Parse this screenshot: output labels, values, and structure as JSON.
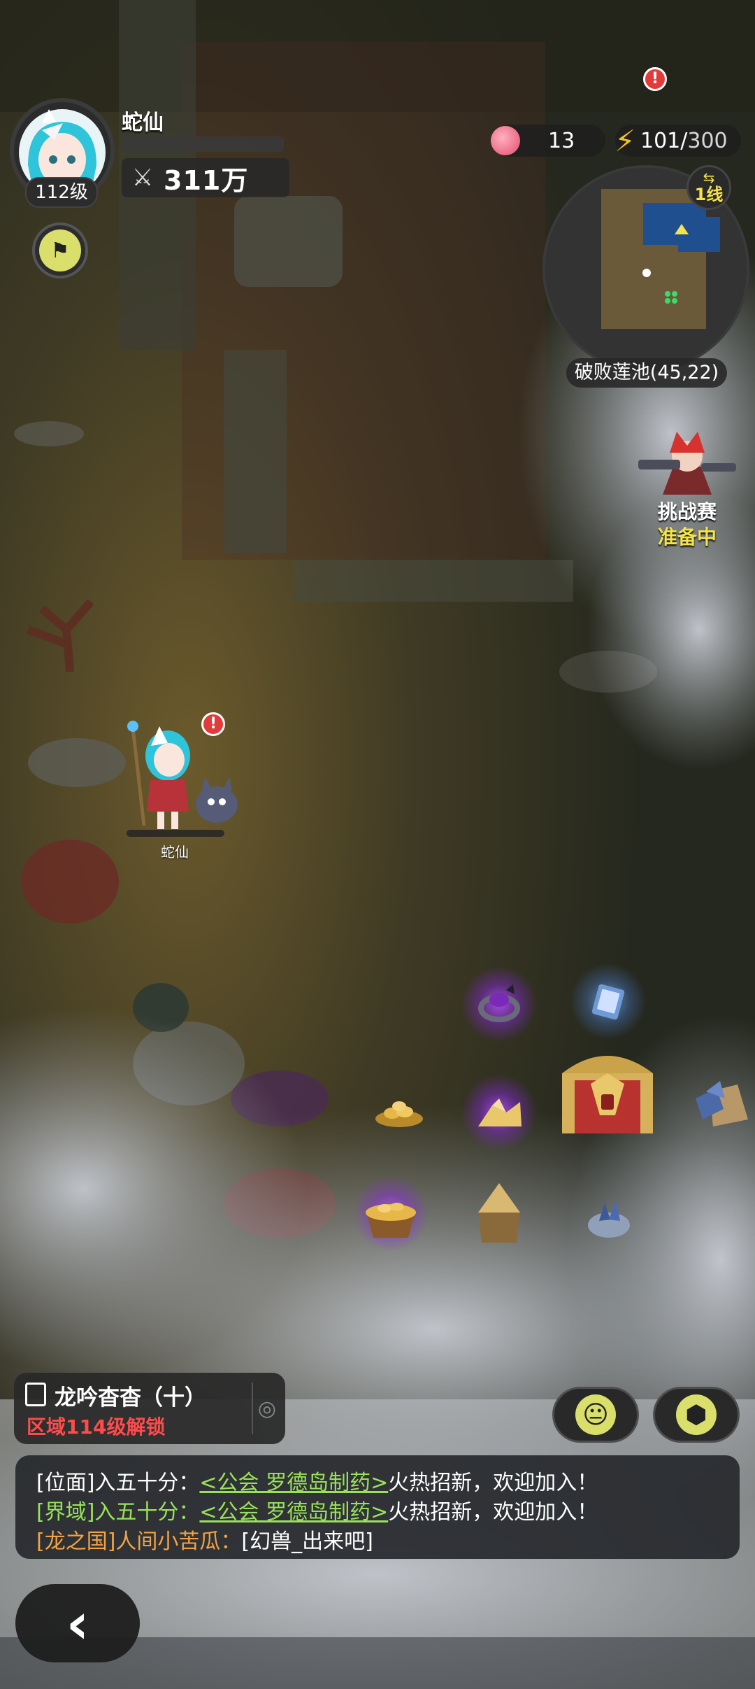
{
  "player": {
    "name": "蛇仙",
    "level": "112级",
    "power": "311万"
  },
  "resources": {
    "peach_count": "13",
    "energy_current": "101/",
    "energy_max": "300"
  },
  "minimap": {
    "line": "1线",
    "location": "破败莲池(45,22)"
  },
  "challenge": {
    "title": "挑战赛",
    "status": "准备中"
  },
  "character": {
    "name": "蛇仙"
  },
  "quest": {
    "title": "龙吟杳杳（十）",
    "requirement": "区域114级解锁"
  },
  "chat": {
    "lines": [
      {
        "tag": "[位面]入五十分：",
        "link": "<公会 罗德岛制药>",
        "text": "火热招新，欢迎加入！"
      },
      {
        "tag": "[界域]入五十分：",
        "link": "<公会 罗德岛制药>",
        "text": "火热招新，欢迎加入！"
      },
      {
        "tag": "[龙之国]人间小苦瓜：",
        "link": "",
        "text": "[幻兽_出来吧]"
      }
    ]
  },
  "icons": {
    "power": "crossed-swords-icon",
    "energy": "lightning-icon",
    "peach": "peach-icon",
    "flag": "flag-icon",
    "emote": "emote-face-icon",
    "cube": "cube-icon",
    "back": "back-arrow-icon",
    "target": "target-icon"
  },
  "colors": {
    "accent_yellow": "#f4e34c",
    "alert_red": "#e23b3b",
    "chat_green": "#98e25a",
    "chat_orange": "#f2a444",
    "quest_red": "#ff4b4b"
  }
}
